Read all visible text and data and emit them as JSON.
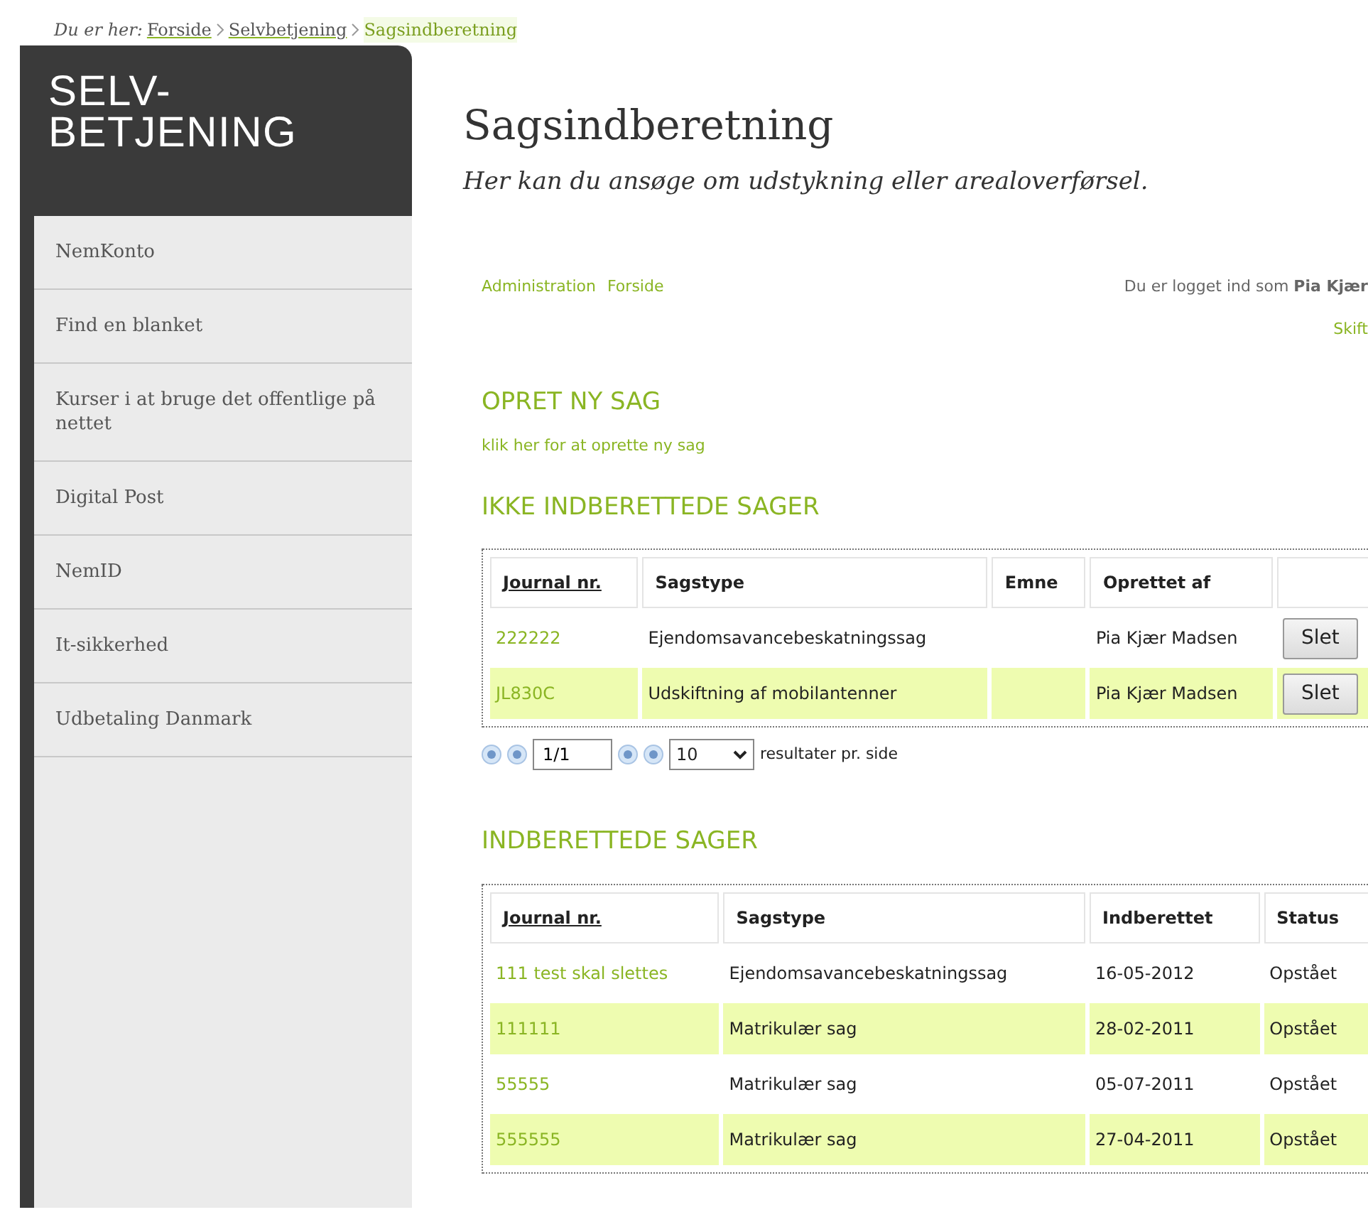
{
  "breadcrumb": {
    "label": "Du er her:",
    "items": [
      {
        "text": "Forside",
        "current": false
      },
      {
        "text": "Selvbetjening",
        "current": false
      },
      {
        "text": "Sagsindberetning",
        "current": true
      }
    ]
  },
  "sidebar": {
    "title": "SELV-\nBETJENING",
    "items": [
      "NemKonto",
      "Find en blanket",
      "Kurser i at bruge det offentlige på nettet",
      "Digital Post",
      "NemID",
      "It-sikkerhed",
      "Udbetaling Danmark"
    ]
  },
  "page": {
    "title": "Sagsindberetning",
    "subtitle": "Her kan du ansøge om udstykning eller arealoverførsel."
  },
  "nav": {
    "links": [
      "Administration",
      "Forside"
    ],
    "login": "Du er logget ind som **Pia Kjær**",
    "switch_link": "Skift"
  },
  "create": {
    "heading": "OPRET NY SAG",
    "link": "klik her for at oprette ny sag"
  },
  "drafts": {
    "heading": "IKKE INDBERETTEDE SAGER",
    "columns": [
      {
        "label": "Journal nr.",
        "sortable": true
      },
      {
        "label": "Sagstype",
        "sortable": false
      },
      {
        "label": "Emne",
        "sortable": false
      },
      {
        "label": "Oprettet af",
        "sortable": false
      }
    ],
    "rows": [
      {
        "journal": "222222",
        "type": "Ejendomsavancebeskatningssag",
        "created_by": "Pia Kjær Madsen",
        "button": "Slet",
        "highlighted": false
      },
      {
        "journal": "JL830C",
        "type": "Udskiftning af mobilantenner",
        "created_by": "Pia Kjær Madsen",
        "button": "Slet",
        "highlighted": true
      }
    ],
    "pager": {
      "page": "1/1",
      "per_page": "10",
      "suffix": "resultater pr. side"
    }
  },
  "submitted": {
    "heading": "INDBERETTEDE SAGER",
    "columns": [
      {
        "label": "Journal nr.",
        "sortable": true
      },
      {
        "label": "Sagstype",
        "sortable": false
      },
      {
        "label": "Indberettet",
        "sortable": false
      },
      {
        "label": "Status",
        "sortable": false
      }
    ],
    "rows": [
      {
        "journal": "111 test skal slettes",
        "type": "Ejendomsavancebeskatningssag",
        "date": "16-05-2012",
        "status": "Opstået",
        "highlighted": false
      },
      {
        "journal": "111111",
        "type": "Matrikulær sag",
        "date": "28-02-2011",
        "status": "Opstået",
        "highlighted": true
      },
      {
        "journal": "55555",
        "type": "Matrikulær sag",
        "date": "05-07-2011",
        "status": "Opstået",
        "highlighted": false
      },
      {
        "journal": "555555",
        "type": "Matrikulær sag",
        "date": "27-04-2011",
        "status": "Opstået",
        "highlighted": true
      }
    ]
  }
}
